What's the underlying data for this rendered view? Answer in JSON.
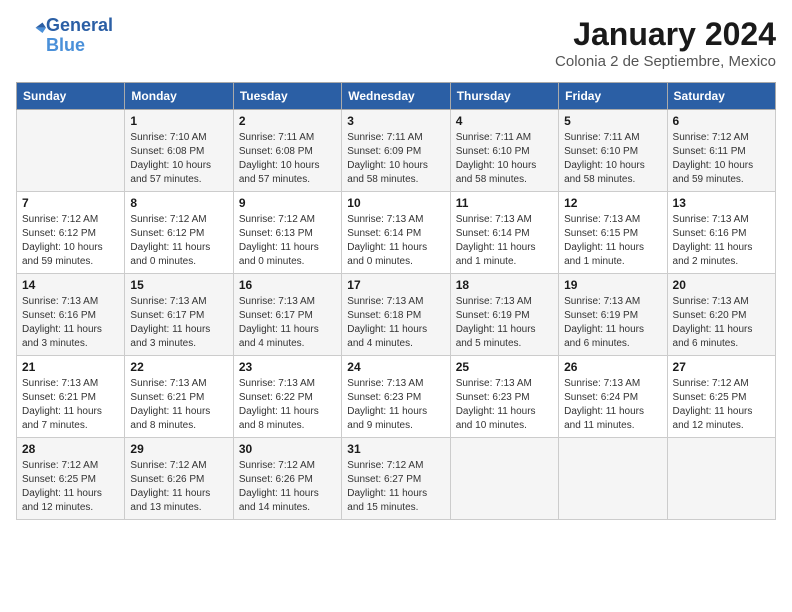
{
  "header": {
    "logo_line1": "General",
    "logo_line2": "Blue",
    "month": "January 2024",
    "location": "Colonia 2 de Septiembre, Mexico"
  },
  "weekdays": [
    "Sunday",
    "Monday",
    "Tuesday",
    "Wednesday",
    "Thursday",
    "Friday",
    "Saturday"
  ],
  "weeks": [
    [
      {
        "day": "",
        "info": ""
      },
      {
        "day": "1",
        "info": "Sunrise: 7:10 AM\nSunset: 6:08 PM\nDaylight: 10 hours\nand 57 minutes."
      },
      {
        "day": "2",
        "info": "Sunrise: 7:11 AM\nSunset: 6:08 PM\nDaylight: 10 hours\nand 57 minutes."
      },
      {
        "day": "3",
        "info": "Sunrise: 7:11 AM\nSunset: 6:09 PM\nDaylight: 10 hours\nand 58 minutes."
      },
      {
        "day": "4",
        "info": "Sunrise: 7:11 AM\nSunset: 6:10 PM\nDaylight: 10 hours\nand 58 minutes."
      },
      {
        "day": "5",
        "info": "Sunrise: 7:11 AM\nSunset: 6:10 PM\nDaylight: 10 hours\nand 58 minutes."
      },
      {
        "day": "6",
        "info": "Sunrise: 7:12 AM\nSunset: 6:11 PM\nDaylight: 10 hours\nand 59 minutes."
      }
    ],
    [
      {
        "day": "7",
        "info": "Sunrise: 7:12 AM\nSunset: 6:12 PM\nDaylight: 10 hours\nand 59 minutes."
      },
      {
        "day": "8",
        "info": "Sunrise: 7:12 AM\nSunset: 6:12 PM\nDaylight: 11 hours\nand 0 minutes."
      },
      {
        "day": "9",
        "info": "Sunrise: 7:12 AM\nSunset: 6:13 PM\nDaylight: 11 hours\nand 0 minutes."
      },
      {
        "day": "10",
        "info": "Sunrise: 7:13 AM\nSunset: 6:14 PM\nDaylight: 11 hours\nand 0 minutes."
      },
      {
        "day": "11",
        "info": "Sunrise: 7:13 AM\nSunset: 6:14 PM\nDaylight: 11 hours\nand 1 minute."
      },
      {
        "day": "12",
        "info": "Sunrise: 7:13 AM\nSunset: 6:15 PM\nDaylight: 11 hours\nand 1 minute."
      },
      {
        "day": "13",
        "info": "Sunrise: 7:13 AM\nSunset: 6:16 PM\nDaylight: 11 hours\nand 2 minutes."
      }
    ],
    [
      {
        "day": "14",
        "info": "Sunrise: 7:13 AM\nSunset: 6:16 PM\nDaylight: 11 hours\nand 3 minutes."
      },
      {
        "day": "15",
        "info": "Sunrise: 7:13 AM\nSunset: 6:17 PM\nDaylight: 11 hours\nand 3 minutes."
      },
      {
        "day": "16",
        "info": "Sunrise: 7:13 AM\nSunset: 6:17 PM\nDaylight: 11 hours\nand 4 minutes."
      },
      {
        "day": "17",
        "info": "Sunrise: 7:13 AM\nSunset: 6:18 PM\nDaylight: 11 hours\nand 4 minutes."
      },
      {
        "day": "18",
        "info": "Sunrise: 7:13 AM\nSunset: 6:19 PM\nDaylight: 11 hours\nand 5 minutes."
      },
      {
        "day": "19",
        "info": "Sunrise: 7:13 AM\nSunset: 6:19 PM\nDaylight: 11 hours\nand 6 minutes."
      },
      {
        "day": "20",
        "info": "Sunrise: 7:13 AM\nSunset: 6:20 PM\nDaylight: 11 hours\nand 6 minutes."
      }
    ],
    [
      {
        "day": "21",
        "info": "Sunrise: 7:13 AM\nSunset: 6:21 PM\nDaylight: 11 hours\nand 7 minutes."
      },
      {
        "day": "22",
        "info": "Sunrise: 7:13 AM\nSunset: 6:21 PM\nDaylight: 11 hours\nand 8 minutes."
      },
      {
        "day": "23",
        "info": "Sunrise: 7:13 AM\nSunset: 6:22 PM\nDaylight: 11 hours\nand 8 minutes."
      },
      {
        "day": "24",
        "info": "Sunrise: 7:13 AM\nSunset: 6:23 PM\nDaylight: 11 hours\nand 9 minutes."
      },
      {
        "day": "25",
        "info": "Sunrise: 7:13 AM\nSunset: 6:23 PM\nDaylight: 11 hours\nand 10 minutes."
      },
      {
        "day": "26",
        "info": "Sunrise: 7:13 AM\nSunset: 6:24 PM\nDaylight: 11 hours\nand 11 minutes."
      },
      {
        "day": "27",
        "info": "Sunrise: 7:12 AM\nSunset: 6:25 PM\nDaylight: 11 hours\nand 12 minutes."
      }
    ],
    [
      {
        "day": "28",
        "info": "Sunrise: 7:12 AM\nSunset: 6:25 PM\nDaylight: 11 hours\nand 12 minutes."
      },
      {
        "day": "29",
        "info": "Sunrise: 7:12 AM\nSunset: 6:26 PM\nDaylight: 11 hours\nand 13 minutes."
      },
      {
        "day": "30",
        "info": "Sunrise: 7:12 AM\nSunset: 6:26 PM\nDaylight: 11 hours\nand 14 minutes."
      },
      {
        "day": "31",
        "info": "Sunrise: 7:12 AM\nSunset: 6:27 PM\nDaylight: 11 hours\nand 15 minutes."
      },
      {
        "day": "",
        "info": ""
      },
      {
        "day": "",
        "info": ""
      },
      {
        "day": "",
        "info": ""
      }
    ]
  ]
}
